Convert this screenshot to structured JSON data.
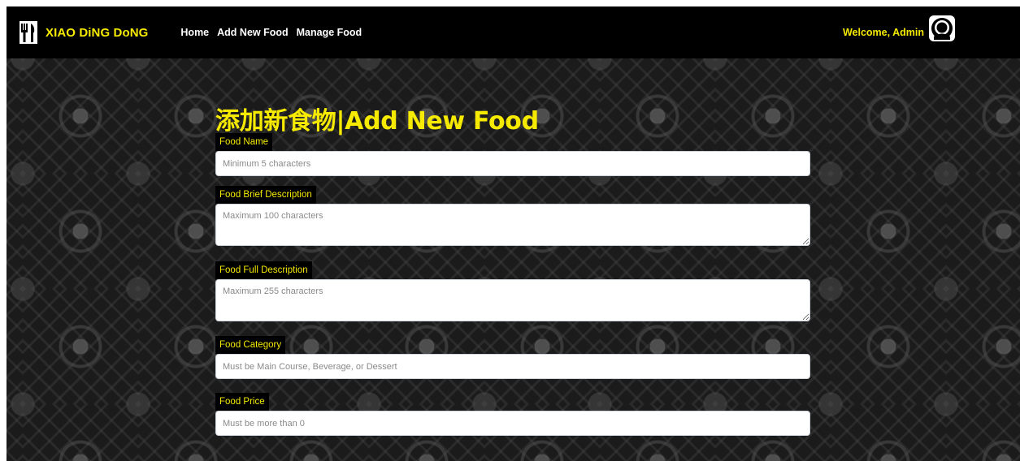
{
  "navbar": {
    "brand": "XIAO DiNG DoNG",
    "links": [
      "Home",
      "Add New Food",
      "Manage Food"
    ],
    "welcome": "Welcome, Admin"
  },
  "form": {
    "title": "添加新食物|Add New Food",
    "fields": [
      {
        "label": "Food Name",
        "placeholder": "Minimum 5 characters",
        "type": "input"
      },
      {
        "label": "Food Brief Description",
        "placeholder": "Maximum 100 characters",
        "type": "textarea"
      },
      {
        "label": "Food Full Description",
        "placeholder": "Maximum 255 characters",
        "type": "textarea"
      },
      {
        "label": "Food Category",
        "placeholder": "Must be Main Course, Beverage, or Dessert",
        "type": "input"
      },
      {
        "label": "Food Price",
        "placeholder": "Must be more than 0",
        "type": "input"
      }
    ]
  },
  "icons": {
    "brand": "fork-knife-icon",
    "avatar": "user-avatar-icon"
  },
  "colors": {
    "accent": "#f5ea00",
    "navbar": "#000000"
  }
}
